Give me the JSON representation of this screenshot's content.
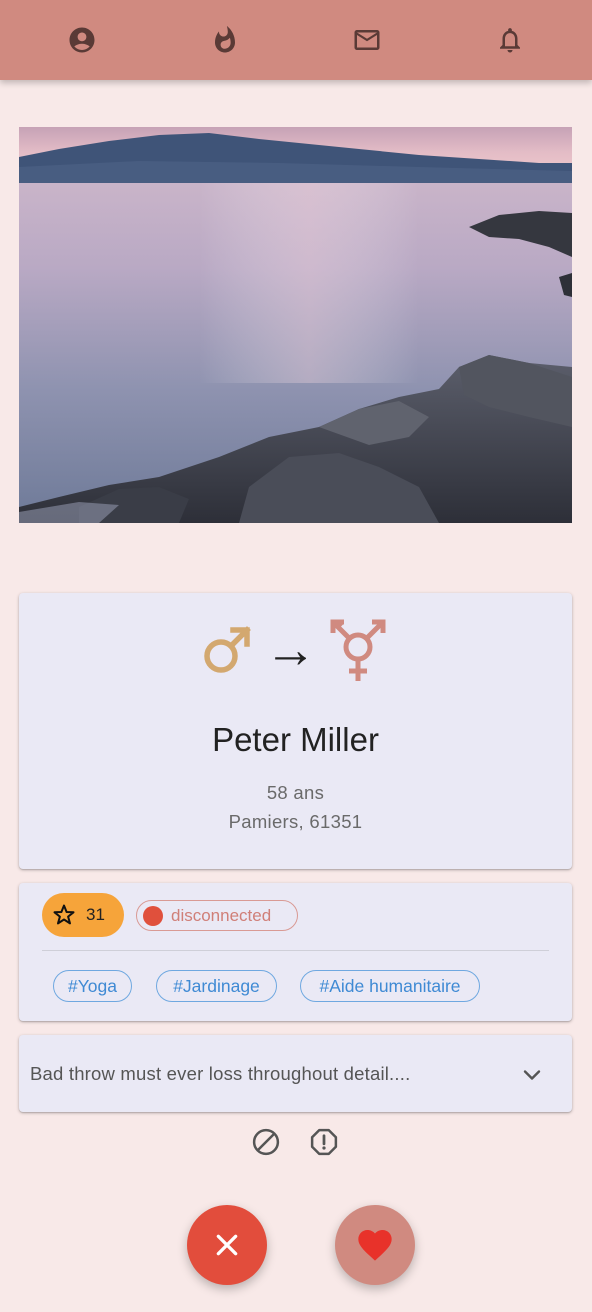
{
  "nav": {
    "items": [
      {
        "icon": "profile-icon"
      },
      {
        "icon": "flame-icon"
      },
      {
        "icon": "mail-icon"
      },
      {
        "icon": "bell-icon"
      }
    ]
  },
  "photo": {
    "subject": "lake-landscape-photo"
  },
  "profile": {
    "gender_from_icon": "male-symbol-icon",
    "gender_to_icon": "transgender-symbol-icon",
    "arrow": "→",
    "name": "Peter Miller",
    "age": "58 ans",
    "location": "Pamiers, 61351"
  },
  "status": {
    "score": "31",
    "connection": "disconnected",
    "tags": [
      "#Yoga",
      "#Jardinage",
      "#Aide humanitaire"
    ]
  },
  "description": {
    "text": "Bad throw must ever loss throughout detail...."
  },
  "colors": {
    "header": "#d08a80",
    "background": "#f8e9e8",
    "card": "#eae9f5",
    "score_chip": "#f6a43a",
    "disconnected": "#e0503c",
    "tag": "#3f8ad4",
    "dislike": "#e24d3c",
    "like": "#d08a80"
  }
}
